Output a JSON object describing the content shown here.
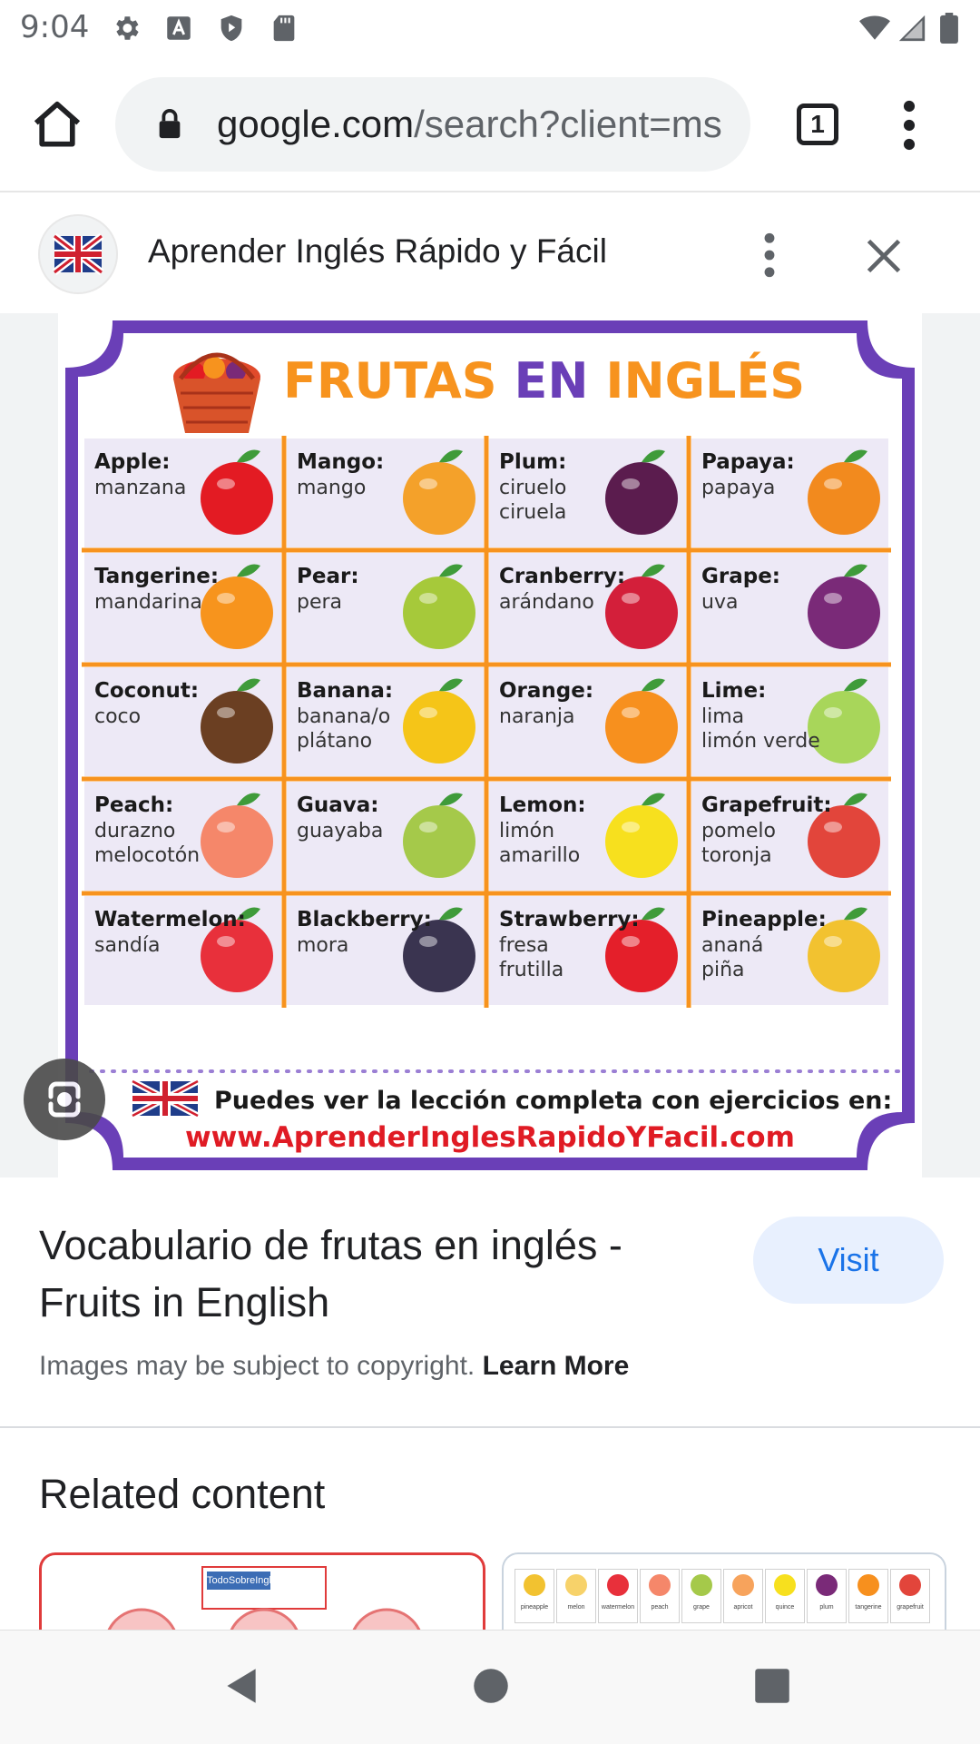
{
  "status": {
    "time": "9:04"
  },
  "browser": {
    "url_host": "google.com",
    "url_path": "/search?client=ms",
    "tab_count": "1"
  },
  "source": {
    "title": "Aprender Inglés Rápido y Fácil"
  },
  "infographic": {
    "title_part1": "FRUTAS",
    "title_part2": "EN",
    "title_part3": "INGLÉS",
    "footer_line": "Puedes ver la lección completa con ejercicios en:",
    "footer_url": "www.AprenderInglesRapidoYFacil.com",
    "fruits": [
      {
        "name": "Apple:",
        "lines": [
          "manzana"
        ],
        "color": "#e31b23"
      },
      {
        "name": "Mango:",
        "lines": [
          "mango"
        ],
        "color": "#f4a12a"
      },
      {
        "name": "Plum:",
        "lines": [
          "ciruelo",
          "ciruela"
        ],
        "color": "#5b1c4e"
      },
      {
        "name": "Papaya:",
        "lines": [
          "papaya"
        ],
        "color": "#f28a1e"
      },
      {
        "name": "Tangerine:",
        "lines": [
          "mandarina"
        ],
        "color": "#f7941d"
      },
      {
        "name": "Pear:",
        "lines": [
          "pera"
        ],
        "color": "#a6c93a"
      },
      {
        "name": "Cranberry:",
        "lines": [
          "arándano"
        ],
        "color": "#d31f3a"
      },
      {
        "name": "Grape:",
        "lines": [
          "uva"
        ],
        "color": "#7a2a78"
      },
      {
        "name": "Coconut:",
        "lines": [
          "coco"
        ],
        "color": "#6b3f22"
      },
      {
        "name": "Banana:",
        "lines": [
          "banana/o",
          "plátano"
        ],
        "color": "#f5c518"
      },
      {
        "name": "Orange:",
        "lines": [
          "naranja"
        ],
        "color": "#f7901e"
      },
      {
        "name": "Lime:",
        "lines": [
          "lima",
          "limón verde"
        ],
        "color": "#a8d65a"
      },
      {
        "name": "Peach:",
        "lines": [
          "durazno",
          "melocotón"
        ],
        "color": "#f5876a"
      },
      {
        "name": "Guava:",
        "lines": [
          "guayaba"
        ],
        "color": "#a5c94a"
      },
      {
        "name": "Lemon:",
        "lines": [
          "limón",
          "amarillo"
        ],
        "color": "#f7e01e"
      },
      {
        "name": "Grapefruit:",
        "lines": [
          "pomelo",
          "toronja"
        ],
        "color": "#e2453b"
      },
      {
        "name": "Watermelon:",
        "lines": [
          "sandía"
        ],
        "color": "#e8303b"
      },
      {
        "name": "Blackberry:",
        "lines": [
          "mora"
        ],
        "color": "#3a3450"
      },
      {
        "name": "Strawberry:",
        "lines": [
          "fresa",
          "frutilla"
        ],
        "color": "#e41f2a"
      },
      {
        "name": "Pineapple:",
        "lines": [
          "ananá",
          "piña"
        ],
        "color": "#f2c230"
      }
    ]
  },
  "result": {
    "title": "Vocabulario de frutas en inglés - Fruits in English",
    "visit_label": "Visit",
    "copyright_text": "Images may be subject to copyright.",
    "learn_more": "Learn More"
  },
  "related": {
    "title": "Related content",
    "card1_label": "TodoSobreInglés",
    "card2_labels": [
      "pineapple",
      "melon",
      "watermelon",
      "peach",
      "grape",
      "apricot",
      "quince",
      "plum",
      "tangerine",
      "grapefruit"
    ]
  },
  "colors": {
    "purple": "#6a3fb7",
    "orange": "#f7931e",
    "red_url": "#e01b24",
    "cell_bg": "#ede9f6",
    "visit_bg": "#e8f0fe",
    "visit_text": "#1a73e8"
  }
}
